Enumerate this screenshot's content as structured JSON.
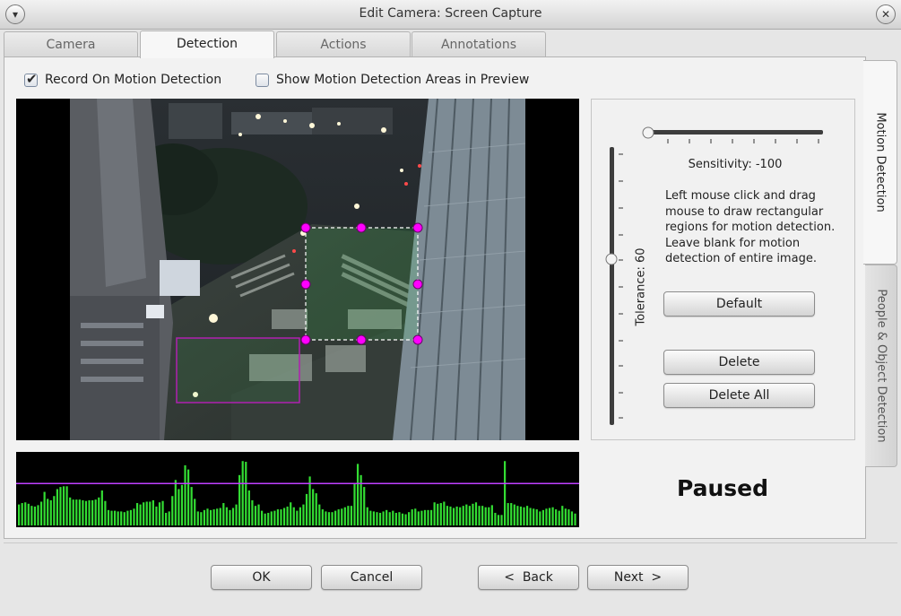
{
  "window": {
    "title": "Edit Camera: Screen Capture"
  },
  "tabs": [
    "Camera",
    "Detection",
    "Actions",
    "Annotations"
  ],
  "side_tabs": [
    "Motion Detection",
    "People & Object Detection"
  ],
  "options": {
    "record_on_motion": {
      "label": "Record On Motion Detection",
      "checked": true
    },
    "show_areas": {
      "label": "Show Motion Detection Areas in Preview",
      "checked": false
    }
  },
  "sensitivity": {
    "label": "Sensitivity: -100",
    "value": -100
  },
  "tolerance": {
    "label": "Tolerance: 60",
    "value": 60
  },
  "instructions": "Left mouse click and drag mouse to draw rectangular regions for motion detection. Leave blank for motion detection of entire image.",
  "buttons": {
    "default": "Default",
    "delete": "Delete",
    "delete_all": "Delete All"
  },
  "status": "Paused",
  "footer": {
    "ok": "OK",
    "cancel": "Cancel",
    "back": "<  Back",
    "next": "Next  >"
  },
  "colors": {
    "region_selected": "#ff00ff",
    "region": "#b020b0",
    "graph_bar": "#33dd33",
    "threshold_line": "#c040ff"
  },
  "icons": {
    "menu": "chevron-down-icon",
    "close": "close-icon"
  },
  "chart_data": {
    "type": "bar",
    "threshold": 60,
    "ylim": [
      0,
      100
    ],
    "values": [
      30,
      32,
      33,
      31,
      28,
      27,
      29,
      34,
      48,
      38,
      36,
      42,
      52,
      55,
      56,
      56,
      40,
      37,
      37,
      37,
      36,
      35,
      36,
      36,
      37,
      40,
      50,
      35,
      22,
      21,
      21,
      20,
      20,
      19,
      21,
      22,
      24,
      32,
      30,
      33,
      34,
      34,
      36,
      27,
      33,
      35,
      18,
      20,
      42,
      65,
      52,
      58,
      86,
      80,
      55,
      38,
      20,
      19,
      22,
      24,
      22,
      23,
      24,
      25,
      32,
      26,
      22,
      25,
      30,
      72,
      92,
      91,
      50,
      36,
      28,
      30,
      21,
      17,
      18,
      20,
      21,
      23,
      23,
      25,
      27,
      33,
      26,
      21,
      26,
      30,
      45,
      70,
      52,
      46,
      30,
      23,
      20,
      19,
      19,
      21,
      23,
      24,
      26,
      28,
      28,
      60,
      88,
      72,
      55,
      26,
      21,
      20,
      19,
      18,
      20,
      22,
      19,
      21,
      18,
      19,
      17,
      16,
      19,
      23,
      24,
      20,
      21,
      22,
      22,
      22,
      33,
      31,
      32,
      34,
      28,
      27,
      25,
      27,
      26,
      28,
      30,
      28,
      31,
      33,
      28,
      28,
      26,
      26,
      29,
      18,
      15,
      15,
      92,
      32,
      32,
      30,
      28,
      27,
      26,
      28,
      25,
      24,
      23,
      20,
      22,
      24,
      25,
      26,
      23,
      21,
      28,
      24,
      23,
      20,
      17
    ]
  }
}
